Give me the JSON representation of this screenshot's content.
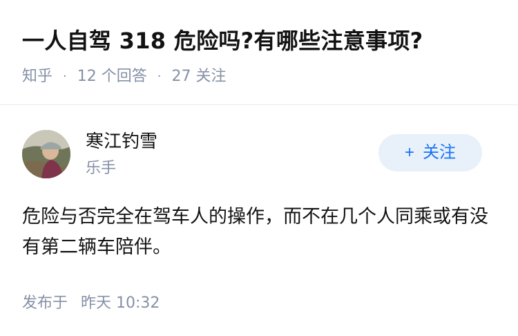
{
  "question": {
    "title": "一人自驾 318 危险吗?有哪些注意事项?",
    "source": "知乎",
    "answer_count": "12 个回答",
    "follower_count": "27 关注"
  },
  "answer": {
    "author": {
      "name": "寒江钓雪",
      "badge": "乐手",
      "avatar_icon": "person-avatar-icon"
    },
    "follow_button": {
      "plus": "+",
      "label": "关注"
    },
    "content": "危险与否完全在驾车人的操作，而不在几个人同乘或有没有第二辆车陪伴。",
    "published_prefix": "发布于",
    "published_time": "昨天 10:32"
  },
  "colors": {
    "accent": "#1772f6",
    "follow_bg": "#e8f0fa",
    "meta_text": "#8590a6",
    "body_text": "#121212",
    "divider": "#ebebeb"
  }
}
